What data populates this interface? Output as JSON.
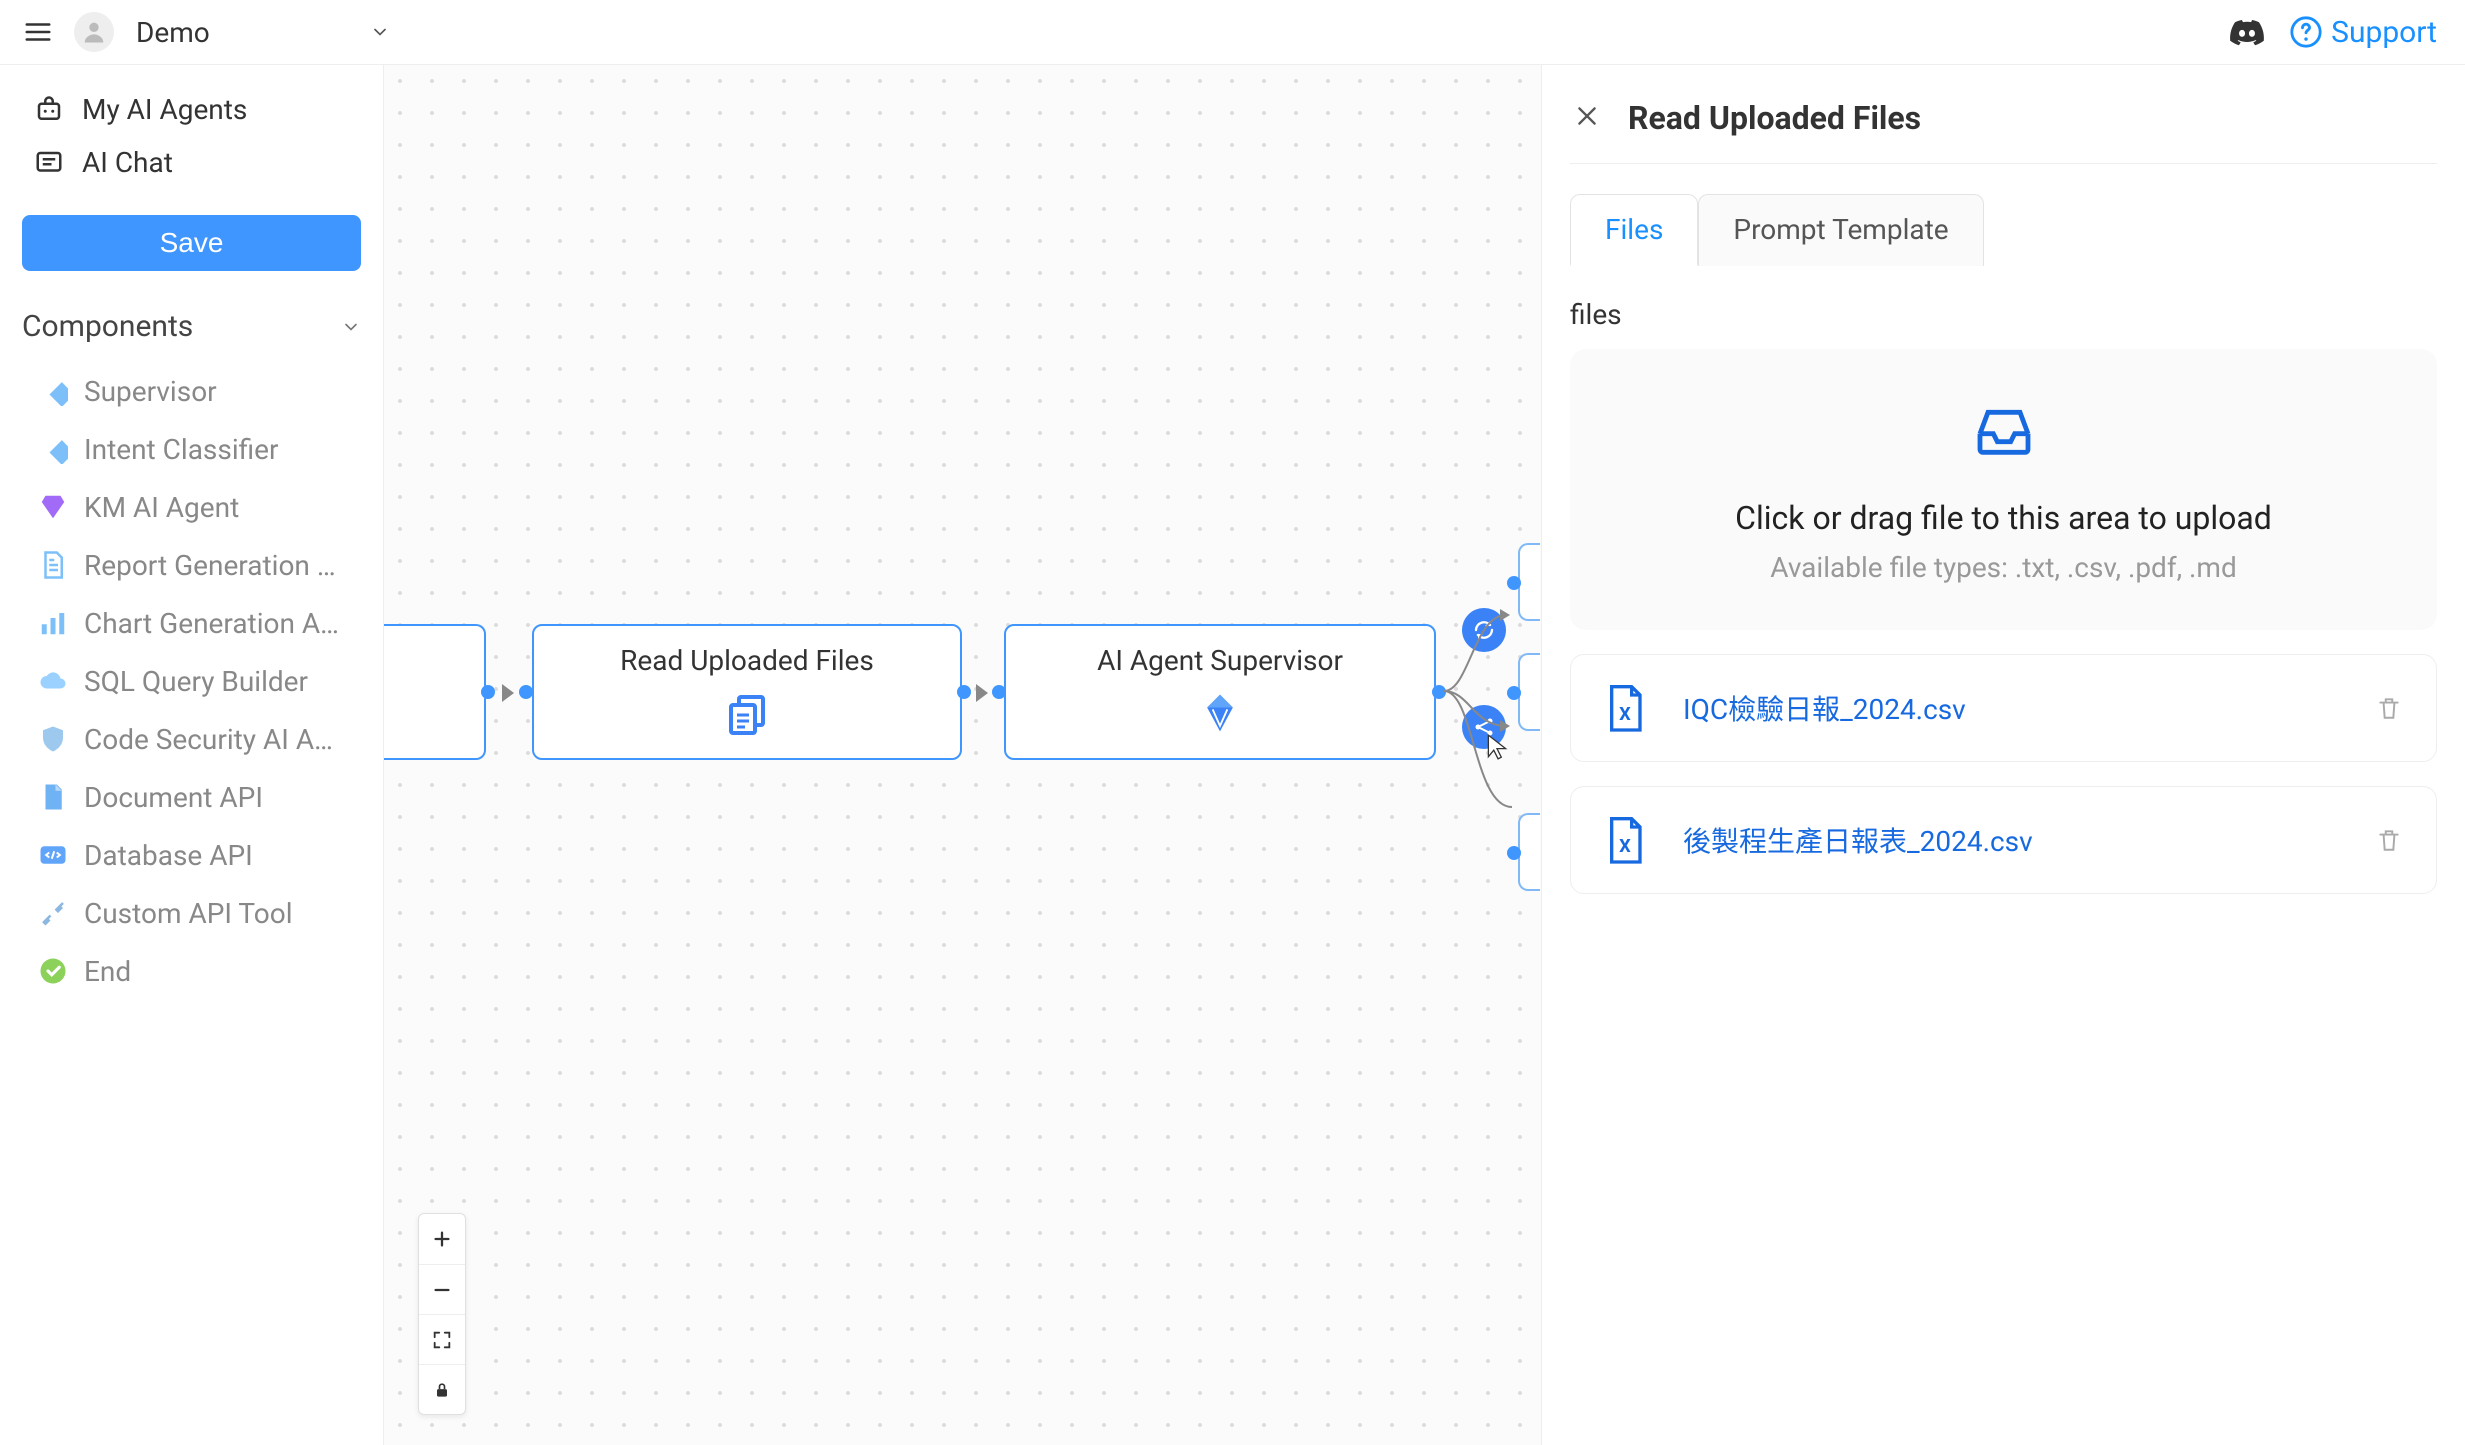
{
  "header": {
    "workspace_name": "Demo",
    "support_label": "Support"
  },
  "sidebar": {
    "nav": {
      "my_agents": "My AI Agents",
      "ai_chat": "AI Chat"
    },
    "save_label": "Save",
    "components_label": "Components",
    "components": [
      {
        "label": "Supervisor",
        "icon": "diamond",
        "color": "#7dc0f9"
      },
      {
        "label": "Intent Classifier",
        "icon": "diamond",
        "color": "#7dc0f9"
      },
      {
        "label": "KM AI Agent",
        "icon": "gem",
        "color": "#a16bf7"
      },
      {
        "label": "Report Generation …",
        "icon": "doc",
        "color": "#7dc0f9"
      },
      {
        "label": "Chart Generation A…",
        "icon": "chart",
        "color": "#7dc0f9"
      },
      {
        "label": "SQL Query Builder",
        "icon": "cloud",
        "color": "#9ad1ff"
      },
      {
        "label": "Code Security AI A…",
        "icon": "shield",
        "color": "#9ec9ee"
      },
      {
        "label": "Document API",
        "icon": "doc2",
        "color": "#70b3f4"
      },
      {
        "label": "Database API",
        "icon": "code",
        "color": "#60a5fa"
      },
      {
        "label": "Custom API Tool",
        "icon": "tools",
        "color": "#8bb7e0"
      },
      {
        "label": "End",
        "icon": "check",
        "color": "#8bd15a"
      }
    ]
  },
  "canvas": {
    "nodes": {
      "read_uploaded_files": {
        "title": "Read Uploaded Files"
      },
      "ai_agent_supervisor": {
        "title": "AI Agent Supervisor"
      }
    }
  },
  "panel": {
    "title": "Read Uploaded Files",
    "tabs": {
      "files": "Files",
      "prompt_template": "Prompt Template"
    },
    "files_label": "files",
    "upload": {
      "title": "Click or drag file to this area to upload",
      "subtitle": "Available file types: .txt, .csv, .pdf, .md"
    },
    "uploaded_files": [
      {
        "name": "IQC檢驗日報_2024.csv"
      },
      {
        "name": "後製程生產日報表_2024.csv"
      }
    ]
  }
}
